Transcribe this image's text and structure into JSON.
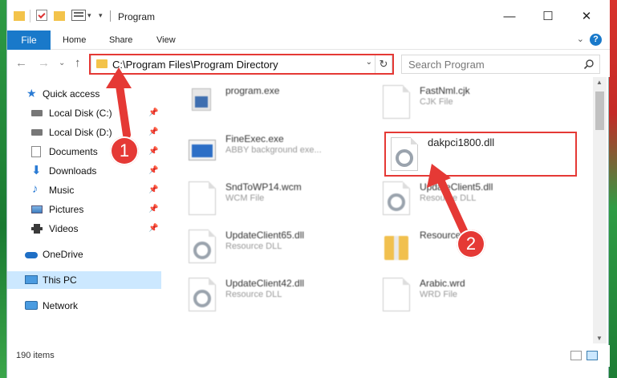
{
  "window": {
    "title": "Program",
    "controls": {
      "minimize": "—",
      "maximize": "☐",
      "close": "✕"
    }
  },
  "ribbon": {
    "tabs": [
      "File",
      "Home",
      "Share",
      "View"
    ],
    "help": "?",
    "collapse": "⌄"
  },
  "nav": {
    "back": "←",
    "forward": "→",
    "recent": "⌄",
    "up": "↑",
    "address": "C:\\Program Files\\Program Directory",
    "address_dropdown": "⌄",
    "refresh": "↻",
    "search_placeholder": "Search Program"
  },
  "sidebar": {
    "items": [
      {
        "label": "Quick access",
        "icon": "star-icon",
        "pinned": false
      },
      {
        "label": "Local Disk (C:)",
        "icon": "drive-icon",
        "pinned": true
      },
      {
        "label": "Local Disk (D:)",
        "icon": "drive-icon",
        "pinned": true
      },
      {
        "label": "Documents",
        "icon": "documents-icon",
        "pinned": true
      },
      {
        "label": "Downloads",
        "icon": "downloads-icon",
        "pinned": true
      },
      {
        "label": "Music",
        "icon": "music-icon",
        "pinned": true
      },
      {
        "label": "Pictures",
        "icon": "pictures-icon",
        "pinned": true
      },
      {
        "label": "Videos",
        "icon": "videos-icon",
        "pinned": true
      },
      {
        "label": "OneDrive",
        "icon": "cloud-icon",
        "pinned": false
      },
      {
        "label": "This PC",
        "icon": "computer-icon",
        "pinned": false,
        "selected": true
      },
      {
        "label": "Network",
        "icon": "network-icon",
        "pinned": false
      }
    ],
    "pin_glyph": "📌"
  },
  "files": [
    {
      "name": "program.exe",
      "desc": ""
    },
    {
      "name": "FastNml.cjk",
      "desc": "CJK File"
    },
    {
      "name": "FineExec.exe",
      "desc": "ABBY background exe..."
    },
    {
      "name": "dakpci1800.dll",
      "desc": ""
    },
    {
      "name": "SndToWP14.wcm",
      "desc": "WCM File"
    },
    {
      "name": "UpdateClient5.dll",
      "desc": "Resource DLL"
    },
    {
      "name": "UpdateClient65.dll",
      "desc": "Resource DLL"
    },
    {
      "name": "Resource",
      "desc": ""
    },
    {
      "name": "UpdateClient42.dll",
      "desc": "Resource DLL"
    },
    {
      "name": "Arabic.wrd",
      "desc": "WRD File"
    }
  ],
  "status": {
    "count": "190 items"
  },
  "callouts": {
    "one": "1",
    "two": "2"
  },
  "colors": {
    "accent": "#1979ca",
    "highlight": "#e53935",
    "selected_bg": "#cce8ff"
  }
}
